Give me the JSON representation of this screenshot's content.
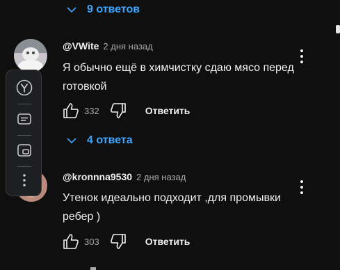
{
  "thread": {
    "top_replies_label": "9 ответов",
    "comments": [
      {
        "author": "@VWite",
        "time": "2 дня назад",
        "text": "Я обычно ещё в химчистку сдаю мясо перед готовкой",
        "likes": "332",
        "reply_label": "Ответить",
        "replies_label": "4 ответа"
      },
      {
        "author": "@kronnna9530",
        "time": "2 дня назад",
        "text": "Утенок идеально подходит ,для промывки ребер )",
        "likes": "303",
        "reply_label": "Ответить"
      }
    ]
  },
  "side_panel": {
    "icons": [
      "yandex-logo-icon",
      "subtitles-icon",
      "picture-in-picture-icon",
      "more-vertical-icon"
    ]
  },
  "colors": {
    "background": "#0f0f0f",
    "accent": "#3ea6ff",
    "text": "#f1f1f1",
    "muted": "#aaaaaa"
  }
}
